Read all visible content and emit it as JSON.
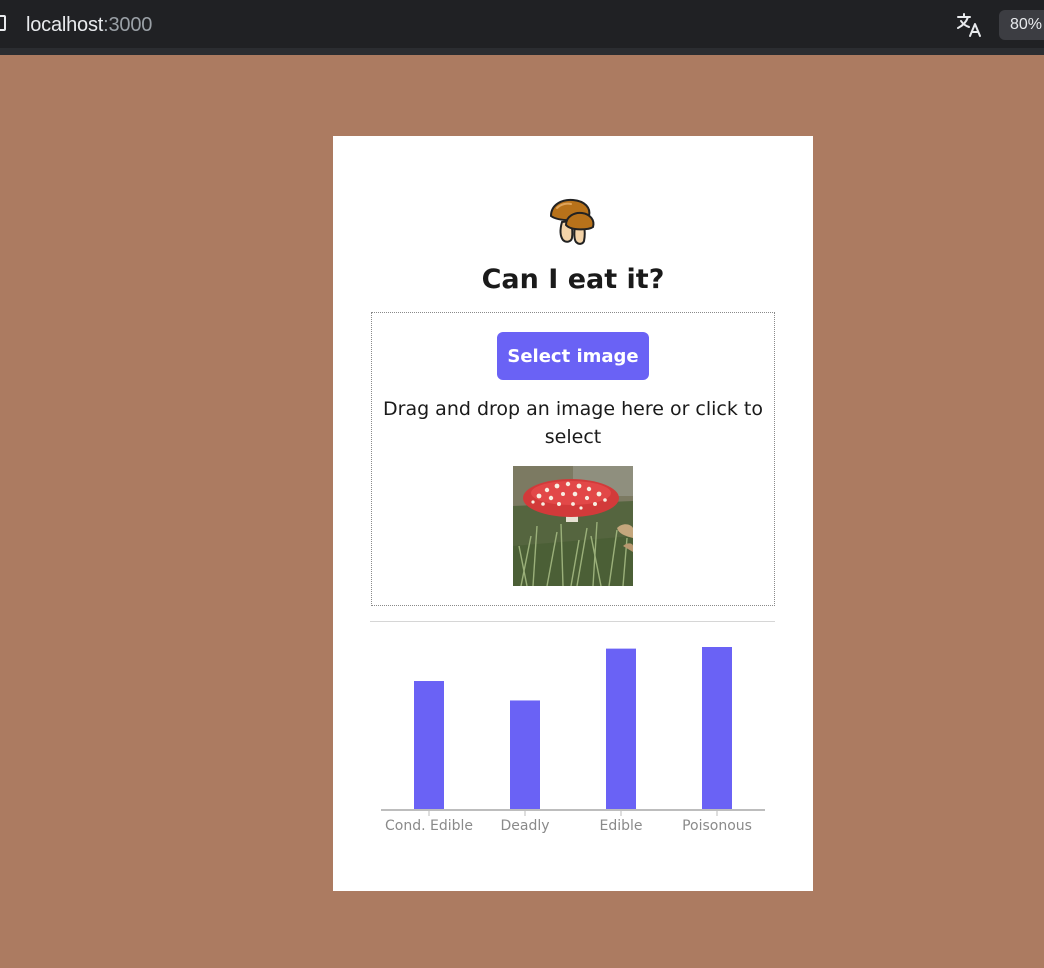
{
  "browser": {
    "url_host": "localhost",
    "url_port": ":3000",
    "zoom": "80%",
    "icons": [
      "page-icon",
      "translate-icon"
    ]
  },
  "page": {
    "logo_icon": "mushroom-icon",
    "title": "Can I eat it?",
    "select_button_label": "Select image",
    "dropzone_text": "Drag and drop an image here or click to select",
    "preview_image": "red-fly-agaric-photo"
  },
  "colors": {
    "background": "#ac7b61",
    "accent": "#6a62f5",
    "bar": "#6a62f5"
  },
  "chart_data": {
    "type": "bar",
    "categories": [
      "Cond. Edible",
      "Deadly",
      "Edible",
      "Poisonous"
    ],
    "values": [
      0.79,
      0.67,
      0.99,
      1.0
    ],
    "ylim": [
      0,
      1
    ],
    "title": "",
    "xlabel": "",
    "ylabel": "",
    "grid": false
  }
}
